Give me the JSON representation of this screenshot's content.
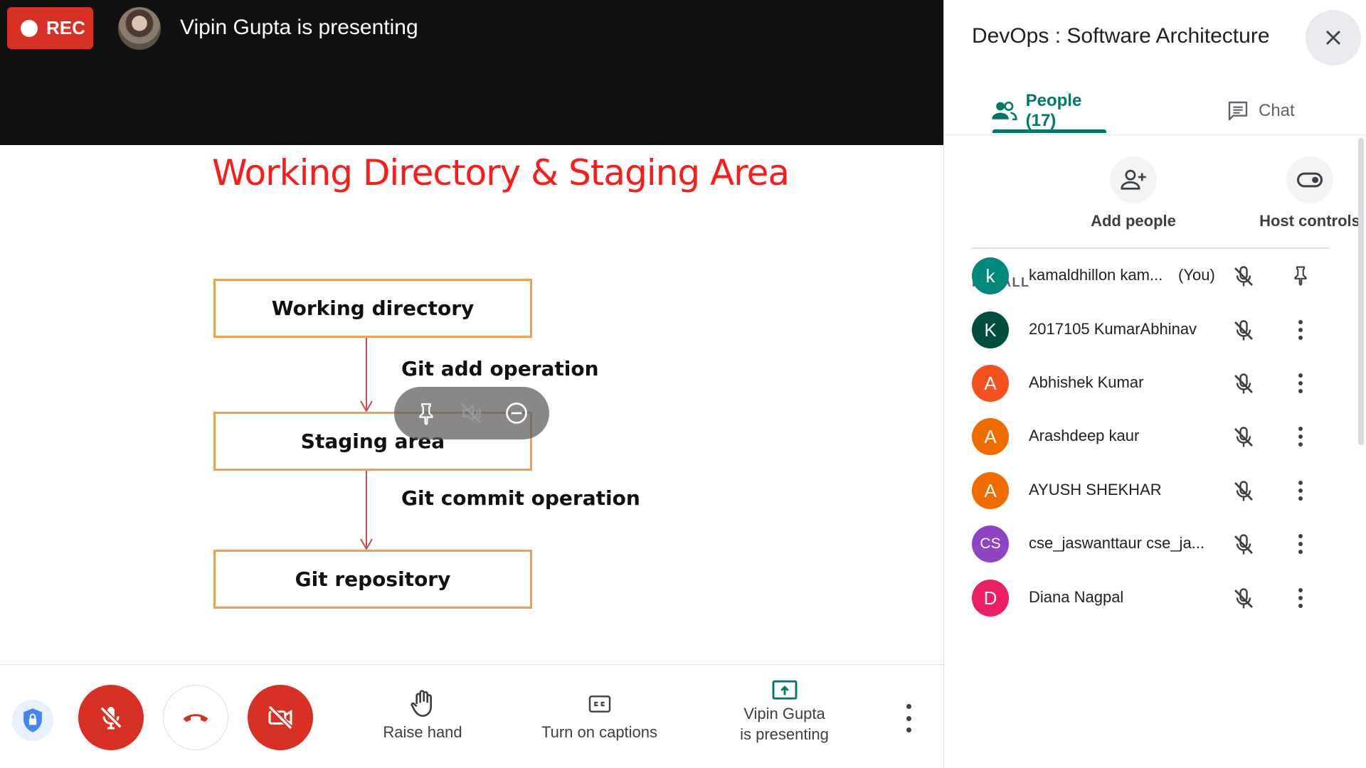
{
  "recording": {
    "label": "REC"
  },
  "presenter": {
    "banner_text": "Vipin Gupta is presenting"
  },
  "slide": {
    "title": "Working Directory & Staging Area",
    "boxes": [
      "Working directory",
      "Staging area",
      "Git repository"
    ],
    "operations": [
      "Git add operation",
      "Git commit operation"
    ]
  },
  "bottom_bar": {
    "raise_hand_label": "Raise hand",
    "captions_label": "Turn on captions",
    "present_line1": "Vipin Gupta",
    "present_line2": "is presenting"
  },
  "panel": {
    "meeting_title": "DevOps : Software Architecture",
    "tabs": {
      "people": "People (17)",
      "chat": "Chat"
    },
    "actions": {
      "add_people": "Add people",
      "host_controls": "Host controls"
    },
    "section_label": "IN CALL",
    "participants": [
      {
        "initial": "k",
        "name": "kamaldhillon kam...",
        "suffix": "(You)",
        "color": "#00897b",
        "trailing": "pin-icon"
      },
      {
        "initial": "K",
        "name": "2017105 KumarAbhinav",
        "color": "#004d40",
        "trailing": "more-vert-icon"
      },
      {
        "initial": "A",
        "name": "Abhishek Kumar",
        "color": "#f4511e",
        "trailing": "more-vert-icon"
      },
      {
        "initial": "A",
        "name": "Arashdeep kaur",
        "color": "#ef6c00",
        "trailing": "more-vert-icon"
      },
      {
        "initial": "A",
        "name": "AYUSH SHEKHAR",
        "color": "#ef6c00",
        "trailing": "more-vert-icon"
      },
      {
        "initial": "CS",
        "name": "cse_jaswanttaur cse_ja...",
        "color": "#8e44c4",
        "trailing": "more-vert-icon"
      },
      {
        "initial": "D",
        "name": "Diana Nagpal",
        "color": "#e91e63",
        "trailing": "more-vert-icon"
      }
    ]
  },
  "colors": {
    "accent_teal": "#00796b",
    "danger_red": "#d93025",
    "slide_title_red": "#ff1a1a",
    "slide_box_border": "#f0a050"
  }
}
